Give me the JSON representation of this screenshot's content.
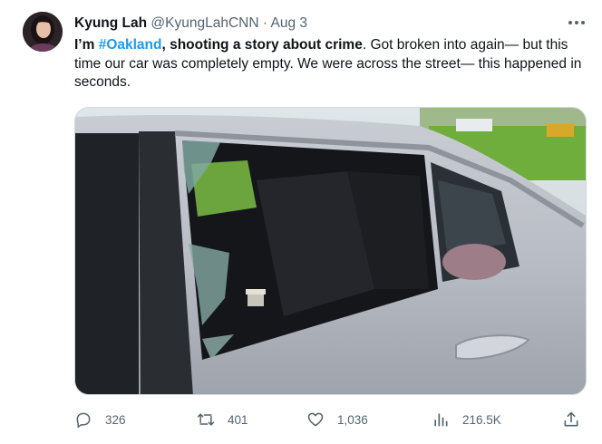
{
  "author": {
    "name": "Kyung Lah",
    "handle": "@KyungLahCNN",
    "separator": "·",
    "date": "Aug 3"
  },
  "tweet": {
    "prefix": "I’m ",
    "hashtag": "#Oakland",
    "bold_rest": ", shooting a story about crime",
    "body": ". Got broken into again— but this time our car was completely empty. We were across the street— this happened in seconds."
  },
  "media": {
    "description_icon": "photo-broken-car-window"
  },
  "actions": {
    "replies": "326",
    "reposts": "401",
    "likes": "1,036",
    "views": "216.5K"
  },
  "colors": {
    "link": "#1d9bf0",
    "muted": "#536471",
    "text": "#0f1419"
  }
}
